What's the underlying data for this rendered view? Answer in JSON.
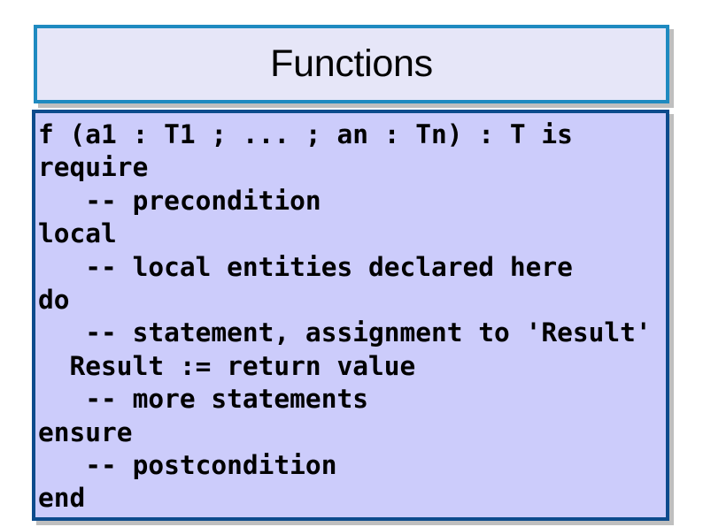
{
  "slide": {
    "title": "Functions",
    "colors": {
      "page_background": "#ffffff",
      "title_fill": "#e6e6f8",
      "title_border": "#1f8ac0",
      "body_fill": "#ccccfb",
      "body_border": "#0d4b8c",
      "shadow": "#bfbfbf",
      "text": "#000000"
    },
    "code_lines": [
      "f (a1 : T1 ; ... ; an : Tn) : T is",
      "require",
      "   -- precondition",
      "local",
      "   -- local entities declared here",
      "do",
      "   -- statement, assignment to 'Result'",
      "  Result := return value",
      "   -- more statements",
      "ensure",
      "   -- postcondition",
      "end"
    ]
  }
}
